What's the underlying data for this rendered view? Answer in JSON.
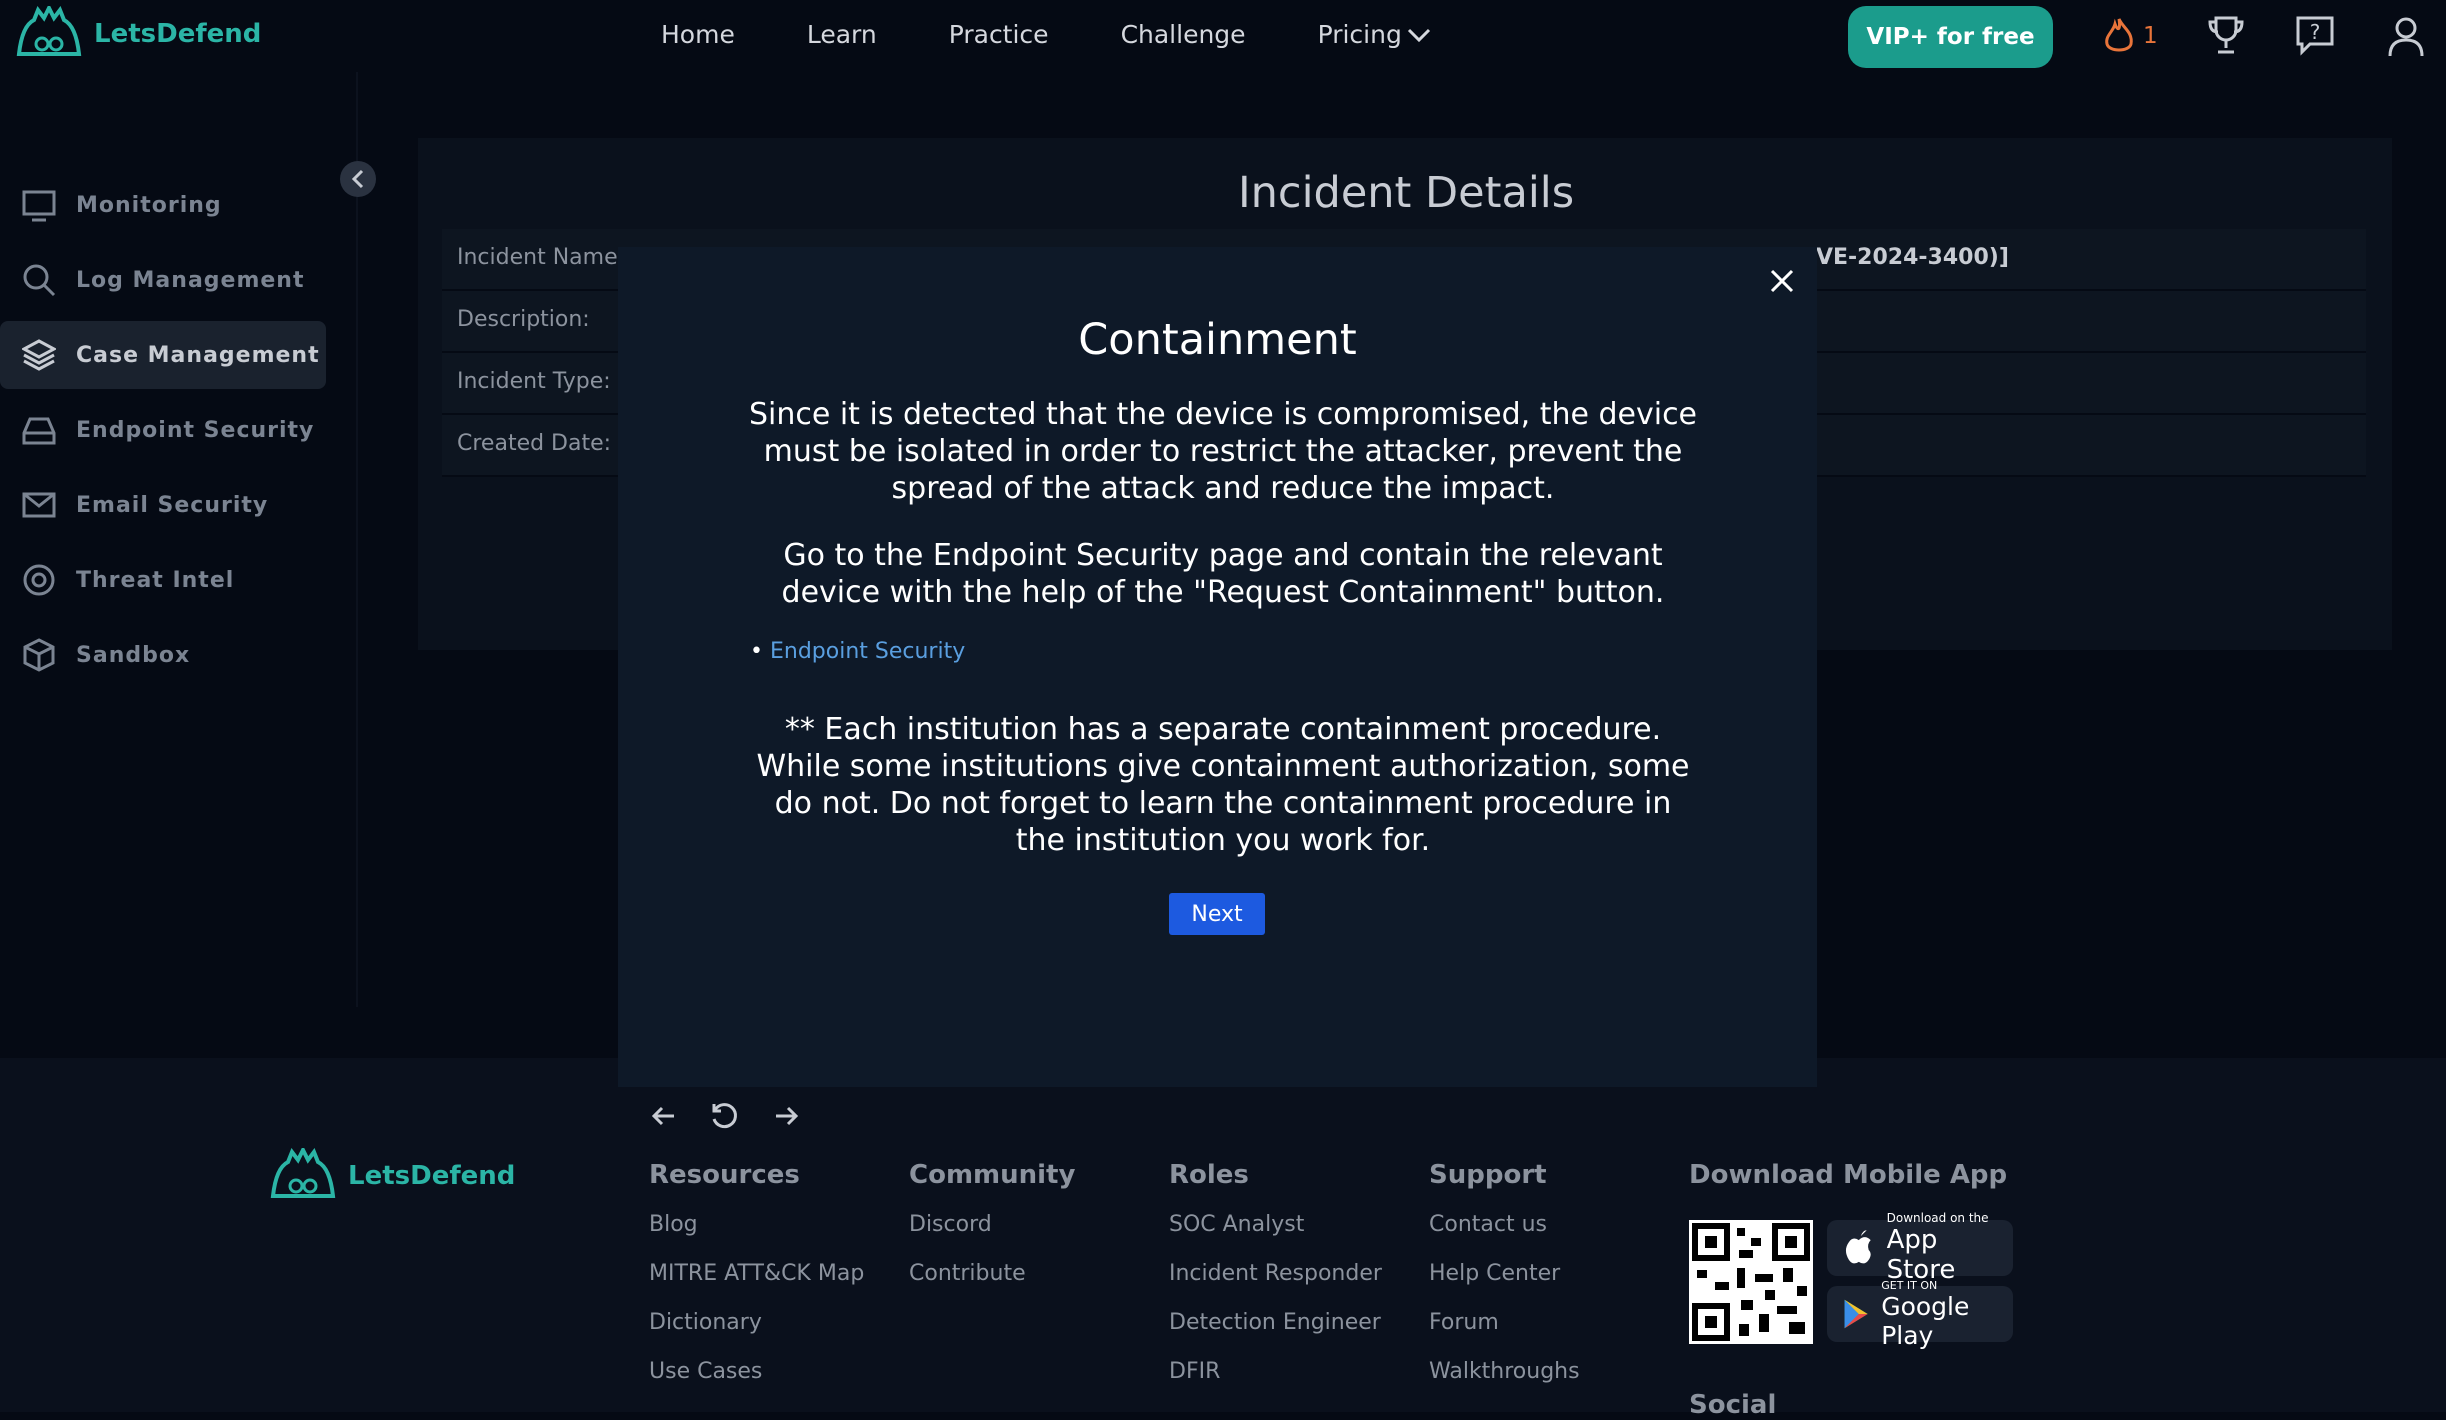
{
  "brand": {
    "name": "LetsDefend"
  },
  "nav": {
    "links": [
      "Home",
      "Learn",
      "Practice",
      "Challenge",
      "Pricing"
    ],
    "vip_button": "VIP+ for free",
    "streak_count": "1"
  },
  "sidebar": {
    "items": [
      "Monitoring",
      "Log Management",
      "Case Management",
      "Endpoint Security",
      "Email Security",
      "Threat Intel",
      "Sandbox"
    ],
    "active": "Case Management"
  },
  "incident": {
    "title": "Incident Details",
    "rows": [
      {
        "label": "Incident Name:",
        "value": "VE-2024-3400)]"
      },
      {
        "label": "Description:",
        "value": ""
      },
      {
        "label": "Incident Type:",
        "value": ""
      },
      {
        "label": "Created Date:",
        "value": ""
      }
    ]
  },
  "modal": {
    "title": "Containment",
    "para1": "Since it is detected that the device is compromised, the device must be isolated in order to restrict the attacker, prevent the spread of the attack and reduce the impact.",
    "para2": "Go to the Endpoint Security page and contain the relevant device with the help of the \"Request Containment\" button.",
    "link": "Endpoint Security",
    "para3": "** Each institution has a separate containment procedure. While some institutions give containment authorization, some do not. Do not forget to learn the containment procedure in the institution you work for.",
    "next_button": "Next"
  },
  "footer": {
    "columns": [
      {
        "title": "Resources",
        "links": [
          "Blog",
          "MITRE ATT&CK Map",
          "Dictionary",
          "Use Cases"
        ]
      },
      {
        "title": "Community",
        "links": [
          "Discord",
          "Contribute"
        ]
      },
      {
        "title": "Roles",
        "links": [
          "SOC Analyst",
          "Incident Responder",
          "Detection Engineer",
          "DFIR"
        ]
      },
      {
        "title": "Support",
        "links": [
          "Contact us",
          "Help Center",
          "Forum",
          "Walkthroughs"
        ]
      }
    ],
    "download_title": "Download Mobile App",
    "app_store_small": "Download on the",
    "app_store": "App Store",
    "google_small": "GET IT ON",
    "google": "Google Play",
    "social_title": "Social"
  }
}
